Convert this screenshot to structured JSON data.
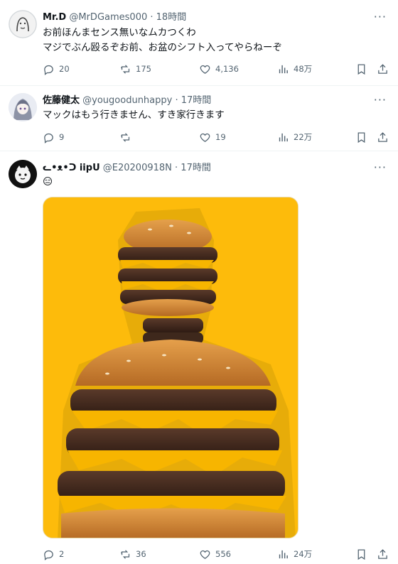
{
  "tweets": [
    {
      "name": "Mr.D",
      "handle": "@MrDGames000",
      "sep": "·",
      "time": "18時間",
      "lines": [
        "お前ほんまセンス無いなムカつくわ",
        "マジでぶん殴るぞお前、お盆のシフト入ってやらねーぞ"
      ],
      "replies": "20",
      "retweets": "175",
      "likes": "4,136",
      "views": "48万"
    },
    {
      "name": "佐藤健太",
      "handle": "@yougoodunhappy",
      "sep": "·",
      "time": "17時間",
      "lines": [
        "マックはもう行きません、すき家行きます"
      ],
      "replies": "9",
      "retweets": "",
      "likes": "19",
      "views": "22万"
    },
    {
      "name": "ᓚ•ᴥ•ᑐ iipᑌ",
      "handle": "@E20200918N",
      "sep": "·",
      "time": "17時間",
      "lines": [
        "😑"
      ],
      "replies": "2",
      "retweets": "36",
      "likes": "556",
      "views": "24万"
    }
  ],
  "more_label": "···",
  "colors": {
    "muted": "#536471",
    "text": "#0f1419",
    "divider": "#eff3f4",
    "media_bg": "#fdbb0b"
  },
  "icons": [
    "reply-icon",
    "retweet-icon",
    "like-icon",
    "views-icon",
    "bookmark-icon",
    "share-icon",
    "more-icon"
  ]
}
